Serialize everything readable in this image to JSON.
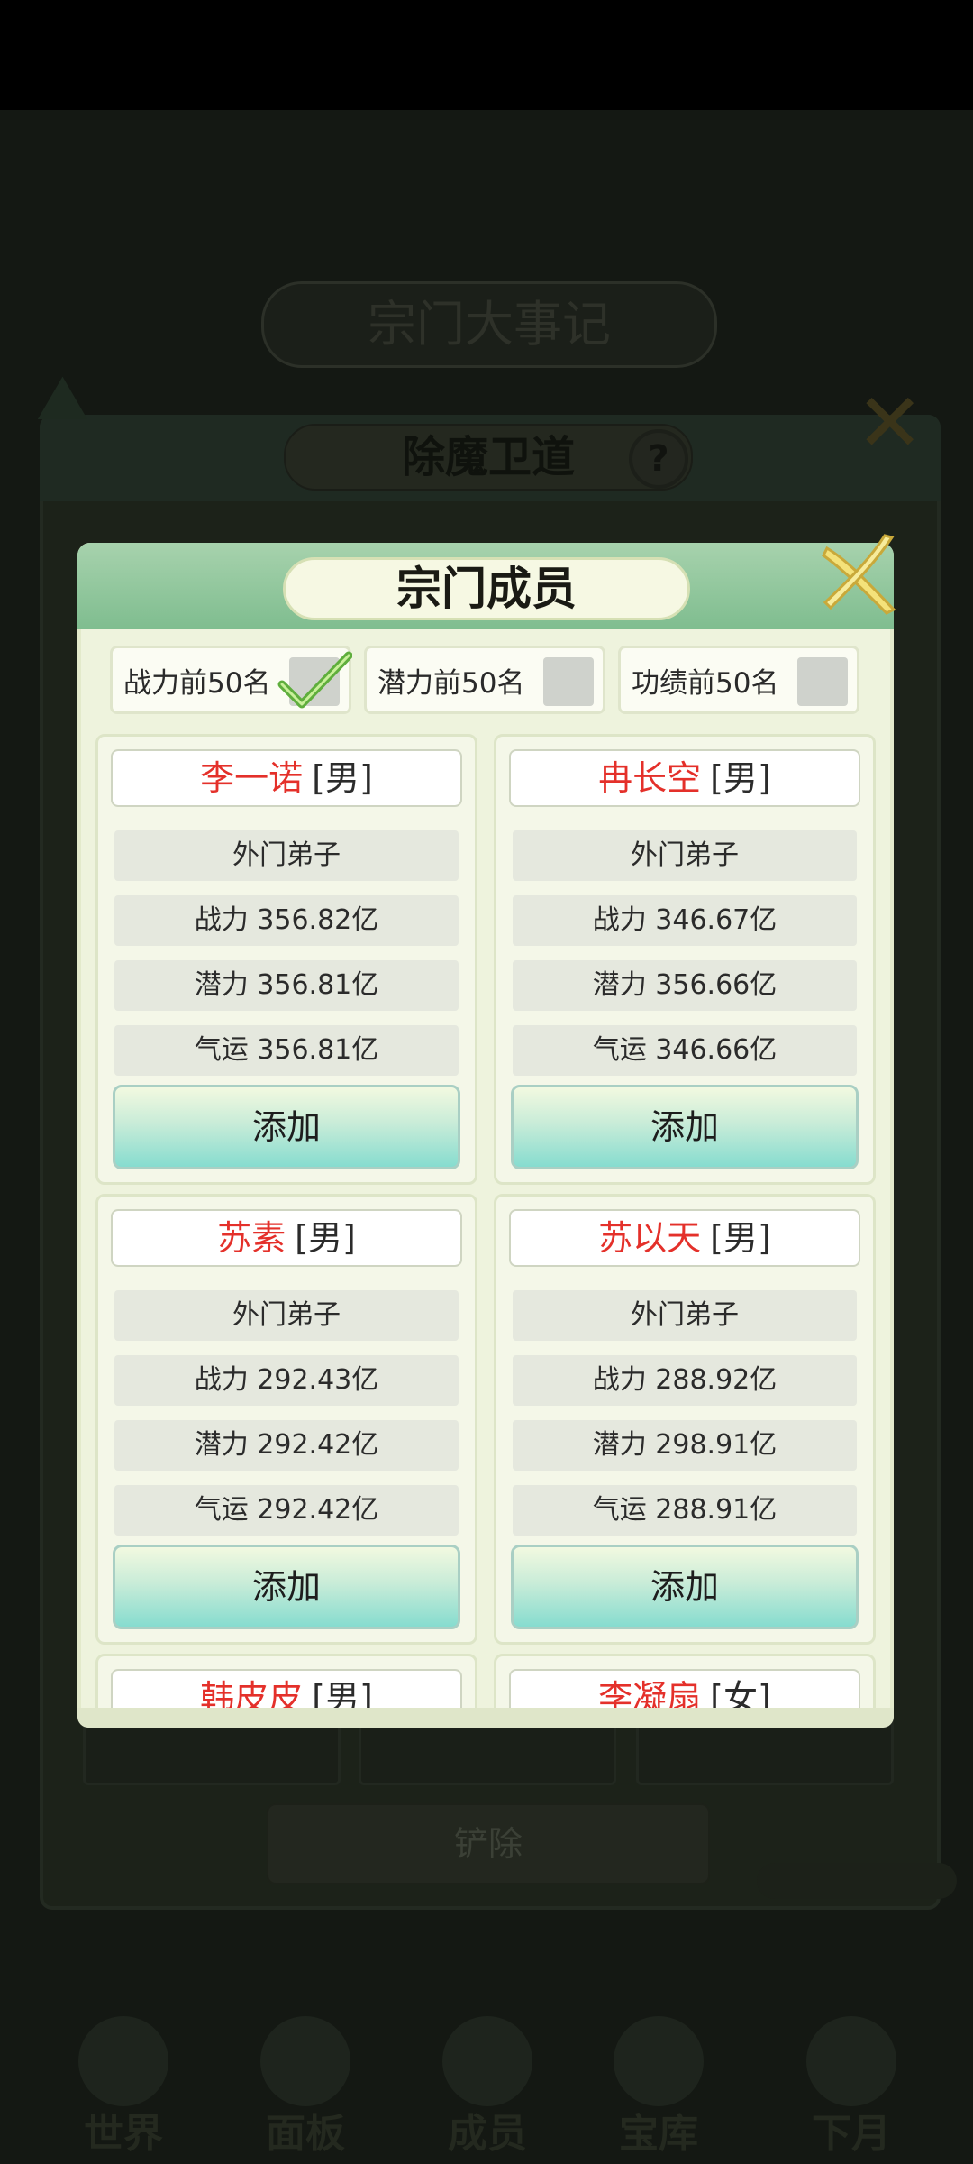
{
  "background": {
    "title": "宗门大事记",
    "sub_title": "除魔卫道",
    "remove_button": "铲除",
    "nav": [
      {
        "label": "世界"
      },
      {
        "label": "面板"
      },
      {
        "label": "成员"
      },
      {
        "label": "宝库"
      },
      {
        "label": "下月"
      }
    ]
  },
  "dialog": {
    "title": "宗门成员",
    "filters": [
      {
        "label": "战力前50名",
        "checked": true
      },
      {
        "label": "潜力前50名",
        "checked": false
      },
      {
        "label": "功绩前50名",
        "checked": false
      }
    ],
    "members": [
      {
        "name": "李一诺",
        "gender": "[男]",
        "rank": "外门弟子",
        "power": "战力 356.82亿",
        "potential": "潜力 356.81亿",
        "luck": "气运 356.81亿",
        "action": "添加"
      },
      {
        "name": "冉长空",
        "gender": "[男]",
        "rank": "外门弟子",
        "power": "战力 346.67亿",
        "potential": "潜力 356.66亿",
        "luck": "气运 346.66亿",
        "action": "添加"
      },
      {
        "name": "苏素",
        "gender": "[男]",
        "rank": "外门弟子",
        "power": "战力 292.43亿",
        "potential": "潜力 292.42亿",
        "luck": "气运 292.42亿",
        "action": "添加"
      },
      {
        "name": "苏以天",
        "gender": "[男]",
        "rank": "外门弟子",
        "power": "战力 288.92亿",
        "potential": "潜力 298.91亿",
        "luck": "气运 288.91亿",
        "action": "添加"
      },
      {
        "name": "韩皮皮",
        "gender": "[男]"
      },
      {
        "name": "李凝扇",
        "gender": "[女]"
      }
    ]
  },
  "colors": {
    "name_red": "#e4302a",
    "header_green": "#7fbd8f",
    "button_cyan": "#86dccf"
  }
}
